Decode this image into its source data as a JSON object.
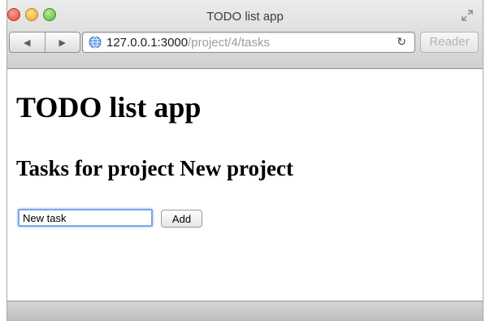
{
  "window": {
    "title": "TODO list app"
  },
  "toolbar": {
    "back_icon": "◀",
    "forward_icon": "▶",
    "url_host": "127.0.0.1:3000",
    "url_path": "/project/4/tasks",
    "reload_icon": "↻",
    "reader_label": "Reader"
  },
  "page": {
    "heading": "TODO list app",
    "subheading": "Tasks for project New project",
    "task_input_value": "New task",
    "add_label": "Add"
  }
}
